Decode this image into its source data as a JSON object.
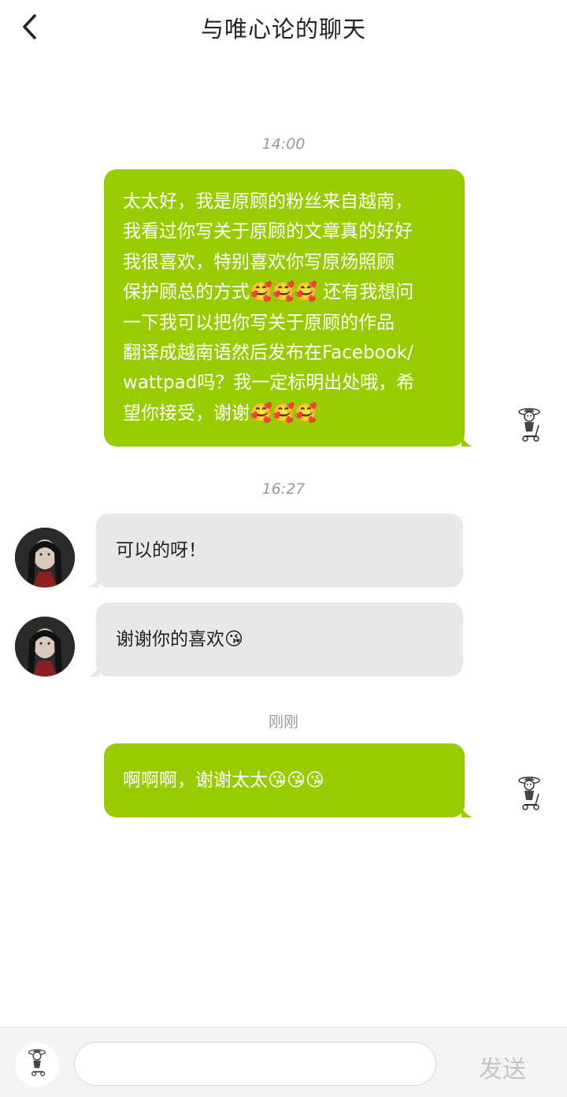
{
  "header": {
    "title": "与唯心论的聊天",
    "back_icon": "chevron-left-icon"
  },
  "timestamps": [
    "14:00",
    "16:27",
    "刚刚"
  ],
  "messages": [
    {
      "sender": "me",
      "lines": [
        "太太好，我是原顾的粉丝来自越南，",
        "我看过你写关于原顾的文章真的好好",
        "我很喜欢，特别喜欢你写原炀照顾",
        "保护顾总的方式🥰🥰🥰 还有我想问",
        "一下我可以把你写关于原顾的作品",
        "翻译成越南语然后发布在Facebook/",
        "wattpad吗？我一定标明出处哦，希",
        "望你接受，谢谢🥰🥰🥰"
      ]
    },
    {
      "sender": "other",
      "text": "可以的呀！"
    },
    {
      "sender": "other",
      "text": "谢谢你的喜欢😘"
    },
    {
      "sender": "me",
      "text": "啊啊啊，谢谢太太😘😘😘"
    }
  ],
  "input": {
    "placeholder": "",
    "value": "",
    "send_label": "发送"
  },
  "colors": {
    "my_bubble": "#99cc00",
    "other_bubble": "#e8e8e8",
    "send_disabled": "#c4c4c4"
  },
  "icons": {
    "other_avatar": "long-hair-avatar",
    "my_avatar": "cartoon-character-avatar"
  }
}
